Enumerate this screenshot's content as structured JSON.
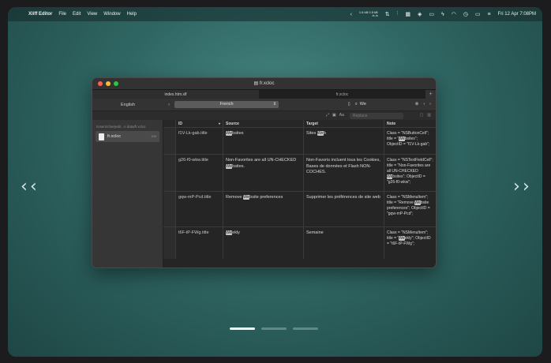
{
  "menubar": {
    "app_name": "Xliff Editor",
    "menus": [
      "File",
      "Edit",
      "View",
      "Window",
      "Help"
    ],
    "stat_top": "1.6 kB 0.5 kB",
    "stat_bottom": "/s /s",
    "clock": "Fri 12 Apr  7:08PM"
  },
  "window": {
    "title": "fr.xcloc",
    "tabs": [
      "index.htm.xlf",
      "fr.xcloc"
    ],
    "source_language": "English",
    "target_language": "French",
    "search_value": "We",
    "replace_placeholder": "Replace",
    "sidebar": {
      "path": "/Users/cherjedi/...n data/fr.xcloc",
      "item_label": "fr.xcloc",
      "item_count": "100"
    },
    "columns": {
      "id": "ID",
      "source": "Source",
      "target": "Target",
      "note": "Note"
    },
    "rows": [
      {
        "id": "f1V-Lk-gab.title",
        "src_pre": "",
        "src_hl": "We",
        "src_post": "bsites",
        "tgt_pre": "Sites ",
        "tgt_hl": "We",
        "tgt_post": "b",
        "note_pre": "Class = \"NSButtonCell\"; title = \"",
        "note_hl": "We",
        "note_post": "bsites\"; ObjectID = \"f1V-Lk-gab\";"
      },
      {
        "id": "g26-f0-wkw.title",
        "src_pre": "Non-Favorites are all UN-CHECKED ",
        "src_hl": "We",
        "src_post": "bsites.",
        "tgt_pre": "Non-Favoris incluent tous les Cookies, Bases de données et Flash NON-COCHES.",
        "tgt_hl": "",
        "tgt_post": "",
        "note_pre": "Class = \"NSTextFieldCell\"; title = \"Non-Favorites are all UN-CHECKED ",
        "note_hl": "We",
        "note_post": "bsites\"; ObjectID = \"g26-f0-wkw\";"
      },
      {
        "id": "gqw-mP-Pcd.title",
        "src_pre": "Remove ",
        "src_hl": "We",
        "src_post": "bsite preferences",
        "tgt_pre": "Supprimer les préférences de site web",
        "tgt_hl": "",
        "tgt_post": "",
        "note_pre": "Class = \"NSMenuItem\"; title = \"Remove ",
        "note_hl": "We",
        "note_post": "bsite preferences\"; ObjectID = \"gqw-mP-Pcd\";"
      },
      {
        "id": "t6F-tP-FWg.title",
        "src_pre": "",
        "src_hl": "We",
        "src_post": "ekly",
        "tgt_pre": "Semaine",
        "tgt_hl": "",
        "tgt_post": "",
        "note_pre": "Class = \"NSMenuItem\"; title = \"",
        "note_hl": "We",
        "note_post": "ekly\"; ObjectID = \"t6F-tP-FWg\";"
      }
    ]
  },
  "nav": {
    "prev": "‹",
    "next": "›"
  },
  "colors": {
    "accent_bg": "#2f6663",
    "window_bg": "#2b2b2b",
    "highlight": "#c7c7c7"
  }
}
